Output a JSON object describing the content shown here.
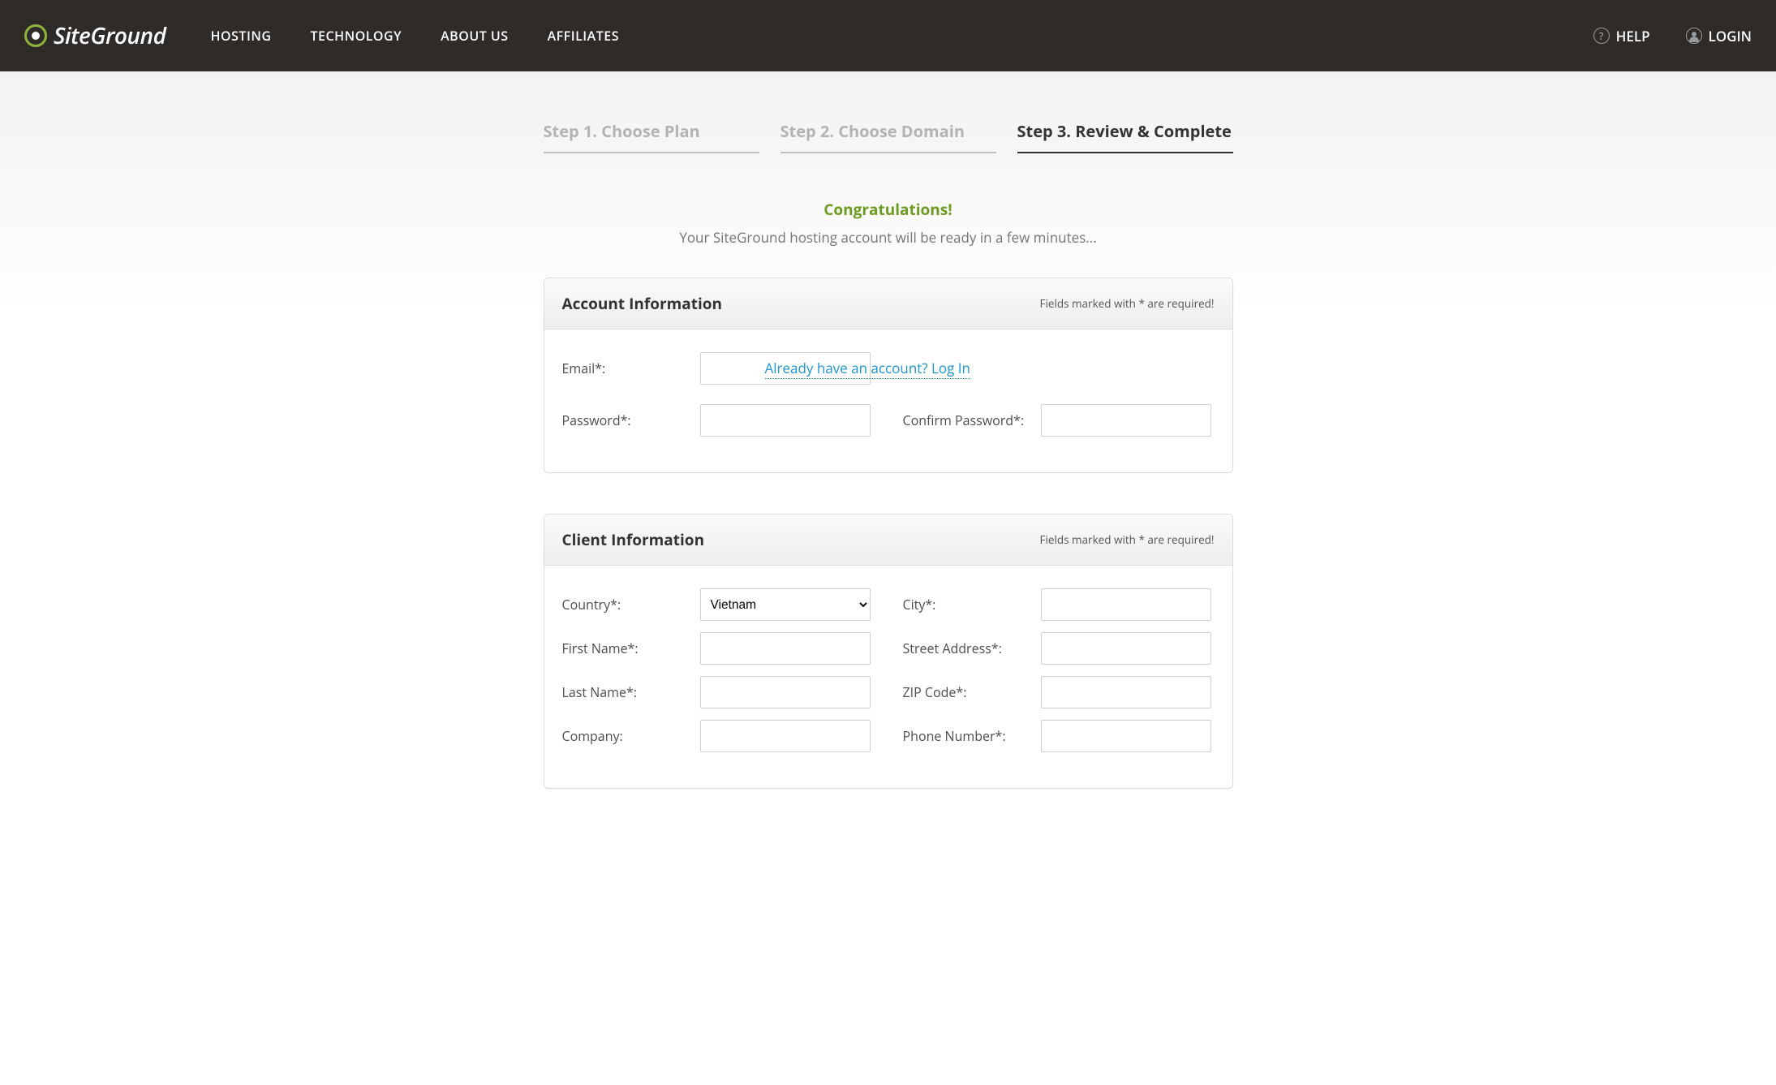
{
  "header": {
    "logo_text": "SiteGround",
    "nav": [
      "HOSTING",
      "TECHNOLOGY",
      "ABOUT US",
      "AFFILIATES"
    ],
    "help": "HELP",
    "login": "LOGIN"
  },
  "steps": {
    "s1": "Step 1. Choose Plan",
    "s2": "Step 2. Choose Domain",
    "s3": "Step 3. Review & Complete"
  },
  "congrats": {
    "title": "Congratulations!",
    "sub": "Your SiteGround hosting account will be ready in a few minutes..."
  },
  "panels": {
    "p1": {
      "title": "Account Information",
      "note": "Fields marked with * are required!",
      "email": "Email*:",
      "login_link": "Already have an account? Log In",
      "password": "Password*:",
      "confirm": "Confirm Password*:"
    },
    "p2": {
      "title": "Client Information",
      "note": "Fields marked with * are required!",
      "country": "Country*:",
      "country_value": "Vietnam",
      "first_name": "First Name*:",
      "last_name": "Last Name*:",
      "company": "Company:",
      "city": "City*:",
      "street": "Street Address*:",
      "zip": "ZIP Code*:",
      "phone": "Phone Number*:"
    }
  }
}
